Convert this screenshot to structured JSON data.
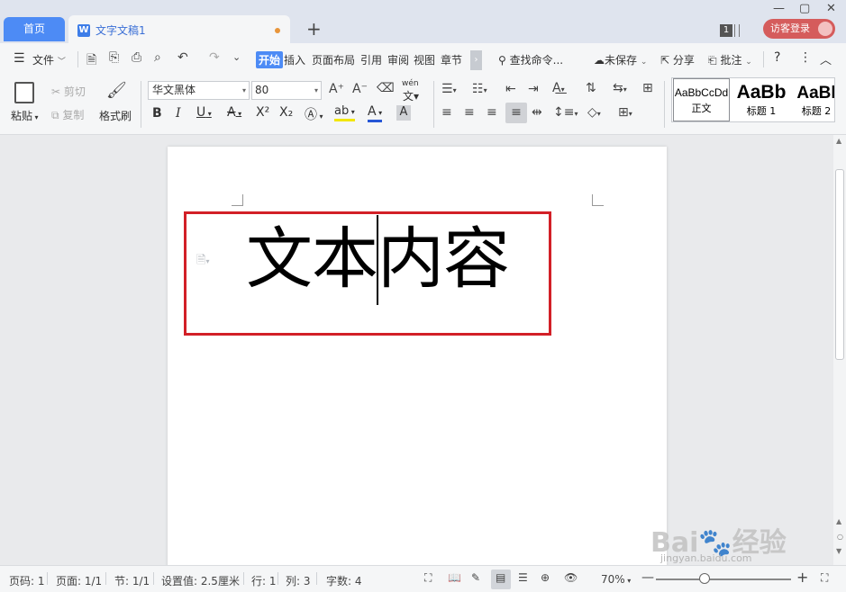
{
  "tabs": {
    "home_label": "首页",
    "doc_icon": "W",
    "doc_name": "文字文稿1",
    "new_tab": "+"
  },
  "window": {
    "window_count": "1",
    "login_label": "访客登录",
    "controls": [
      "—",
      "▢",
      "✕"
    ]
  },
  "menu": {
    "file_label": "文件",
    "tabs": [
      "开始",
      "插入",
      "页面布局",
      "引用",
      "审阅",
      "视图",
      "章节"
    ],
    "search_label": "查找命令...",
    "unsaved_label": "未保存",
    "share_label": "分享",
    "comment_label": "批注",
    "help_icon": "?"
  },
  "ribbon": {
    "paste_label": "粘贴",
    "cut_label": "剪切",
    "copy_label": "复制",
    "format_painter_label": "格式刷",
    "font_name": "华文黑体",
    "font_size": "80",
    "pinyin_label": "wén",
    "styles": [
      {
        "preview": "AaBbCcDd",
        "label": "正文"
      },
      {
        "preview": "AaBb",
        "label": "标题 1"
      },
      {
        "preview": "AaBl",
        "label": "标题 2"
      }
    ]
  },
  "document": {
    "text": "文本内容"
  },
  "watermark": {
    "brand": "Bai🐾经验",
    "url": "jingyan.baidu.com"
  },
  "status": {
    "page": "页码: 1",
    "pages": "页面: 1/1",
    "section": "节: 1/1",
    "setting": "设置值: 2.5厘米",
    "row": "行: 1",
    "col": "列: 3",
    "word_count": "字数: 4",
    "zoom": "70%"
  },
  "colors": {
    "accent": "#4d8bf5",
    "highlight_border": "#d22027",
    "login_button": "#d55c5c",
    "unsaved_dot": "#e8953a"
  }
}
